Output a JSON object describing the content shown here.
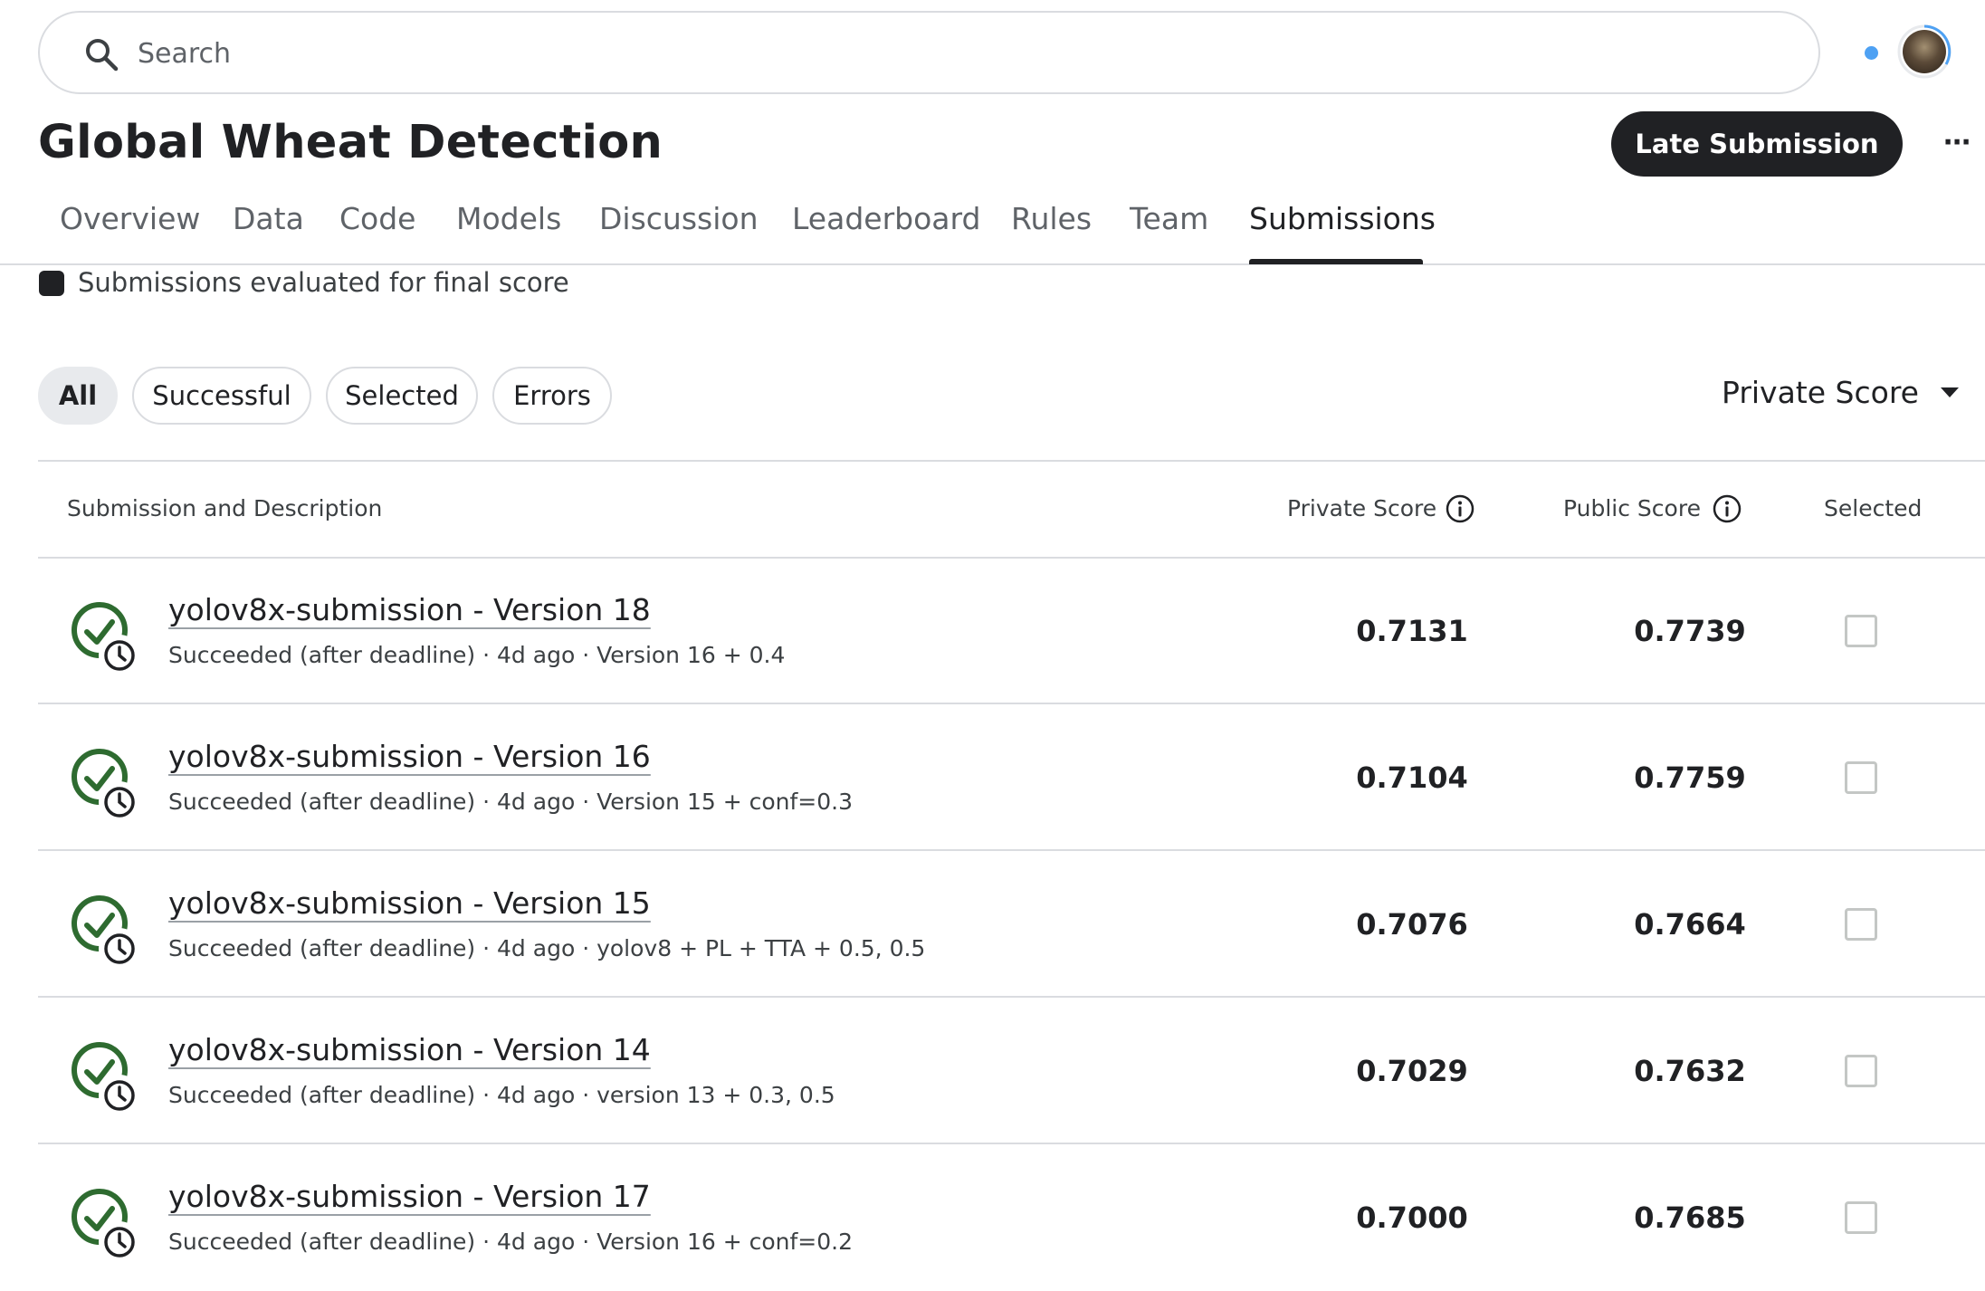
{
  "search": {
    "placeholder": "Search"
  },
  "header": {
    "title": "Global Wheat Detection",
    "late_submission_label": "Late Submission",
    "more_label": "⋯"
  },
  "tabs": [
    {
      "label": "Overview"
    },
    {
      "label": "Data"
    },
    {
      "label": "Code"
    },
    {
      "label": "Models"
    },
    {
      "label": "Discussion"
    },
    {
      "label": "Leaderboard"
    },
    {
      "label": "Rules"
    },
    {
      "label": "Team"
    },
    {
      "label": "Submissions",
      "active": true
    }
  ],
  "legend": {
    "text": "Submissions evaluated for final score"
  },
  "filters": [
    {
      "label": "All",
      "active": true
    },
    {
      "label": "Successful"
    },
    {
      "label": "Selected"
    },
    {
      "label": "Errors"
    }
  ],
  "sort": {
    "label": "Private Score"
  },
  "table": {
    "headers": {
      "submission": "Submission and Description",
      "private": "Private Score",
      "public": "Public Score",
      "selected": "Selected"
    },
    "rows": [
      {
        "name": "yolov8x-submission - Version 18",
        "status": "Succeeded (after deadline)",
        "age": "4d ago",
        "description": "Version 16 + 0.4",
        "private_score": "0.7131",
        "public_score": "0.7739",
        "selected": false
      },
      {
        "name": "yolov8x-submission - Version 16",
        "status": "Succeeded (after deadline)",
        "age": "4d ago",
        "description": "Version 15 + conf=0.3",
        "private_score": "0.7104",
        "public_score": "0.7759",
        "selected": false
      },
      {
        "name": "yolov8x-submission - Version 15",
        "status": "Succeeded (after deadline)",
        "age": "4d ago",
        "description": "yolov8 + PL + TTA + 0.5, 0.5",
        "private_score": "0.7076",
        "public_score": "0.7664",
        "selected": false
      },
      {
        "name": "yolov8x-submission - Version 14",
        "status": "Succeeded (after deadline)",
        "age": "4d ago",
        "description": "version 13 + 0.3, 0.5",
        "private_score": "0.7029",
        "public_score": "0.7632",
        "selected": false
      },
      {
        "name": "yolov8x-submission - Version 17",
        "status": "Succeeded (after deadline)",
        "age": "4d ago",
        "description": "Version 16 + conf=0.2",
        "private_score": "0.7000",
        "public_score": "0.7685",
        "selected": false
      }
    ]
  },
  "colors": {
    "success_green": "#2e6b30",
    "accent_dot": "#4ea1f3",
    "dark": "#202124"
  },
  "icons": {
    "search": "search-icon",
    "info": "info-icon",
    "status": "check-circle-clock-icon",
    "more": "more-horizontal-icon"
  }
}
